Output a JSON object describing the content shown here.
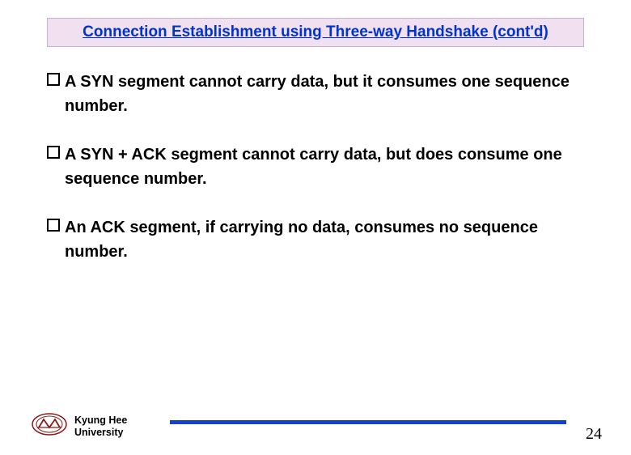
{
  "title": "Connection Establishment using Three-way Handshake (cont'd)",
  "bullets": [
    "A SYN segment cannot carry data, but it consumes one sequence number.",
    "A SYN + ACK segment cannot carry data, but does consume one sequence number.",
    "An ACK segment, if carrying no data, consumes no sequence number."
  ],
  "footer": {
    "uni_line1": "Kyung Hee",
    "uni_line2": "University",
    "page": "24"
  },
  "colors": {
    "title_fg": "#0033cc",
    "title_bg": "#f0e0f0",
    "line": "#1540c8",
    "logo": "#8a1a1a"
  }
}
